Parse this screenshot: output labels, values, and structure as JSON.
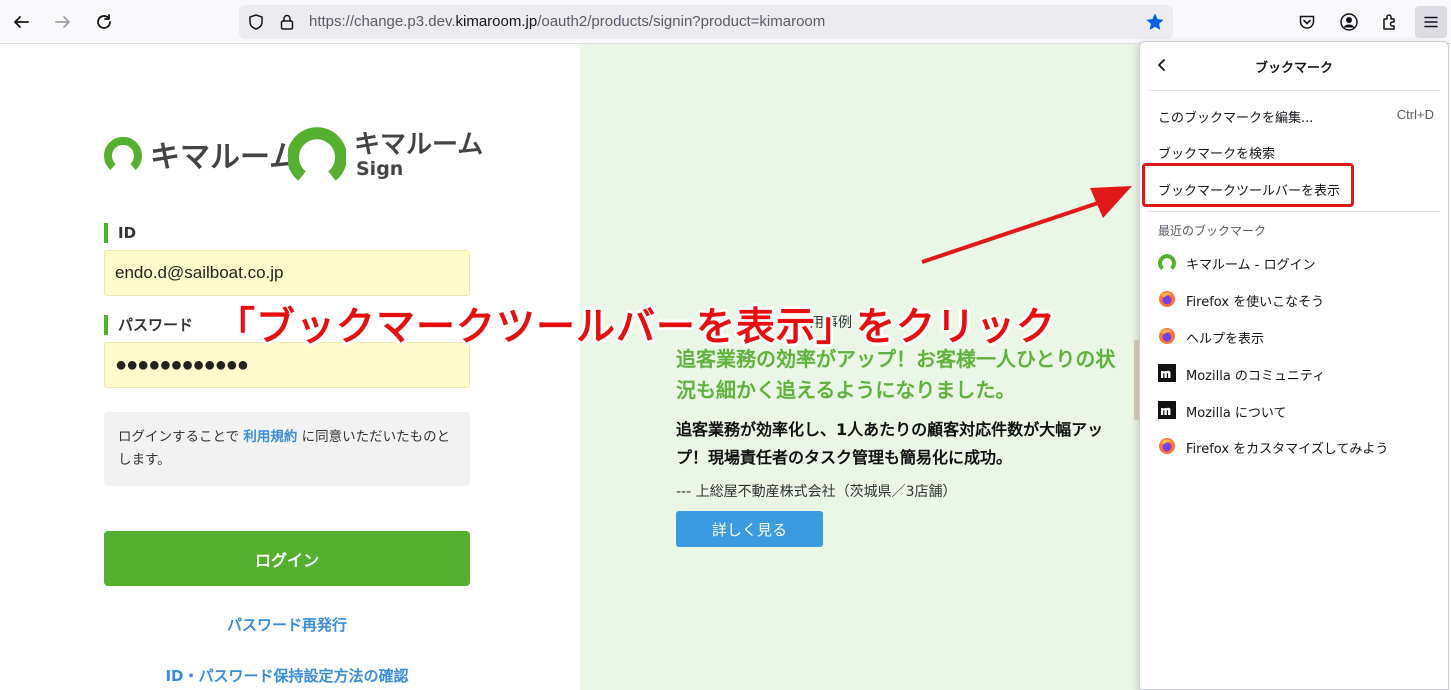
{
  "browser": {
    "url_prefix": "https://change.p3.dev.",
    "url_domain": "kimaroom.jp",
    "url_path": "/oauth2/products/signin?product=kimaroom"
  },
  "login": {
    "logo_main": "キマルーム",
    "logo_sign_main": "キマルーム",
    "logo_sign_sub": "Sign",
    "id_label": "ID",
    "id_value": "endo.d@sailboat.co.jp",
    "password_label": "パスワード",
    "password_value": "●●●●●●●●●●●●",
    "agree_prefix": "ログインすることで ",
    "agree_link": "利用規約",
    "agree_suffix": " に同意いただいたものとします。",
    "login_button": "ログイン",
    "reset_link": "パスワード再発行",
    "settings_link": "ID・パスワード保持設定方法の確認"
  },
  "case_study": {
    "label": "用事例",
    "headline": "追客業務の効率がアップ！お客様一人ひとりの状況も細かく追えるようになりました。",
    "body": "追客業務が効率化し、1人あたりの顧客対応件数が大幅アップ！現場責任者のタスク管理も簡易化に成功。",
    "source": "--- 上総屋不動産株式会社（茨城県／3店舗）",
    "detail_button": "詳しく見る"
  },
  "bookmark_menu": {
    "title": "ブックマーク",
    "edit_label": "このブックマークを編集...",
    "edit_shortcut": "Ctrl+D",
    "search_label": "ブックマークを検索",
    "toolbar_label": "ブックマークツールバーを表示",
    "recent_label": "最近のブックマーク",
    "recent": [
      {
        "label": "キマルーム - ログイン",
        "icon": "kimaroom-icon"
      },
      {
        "label": "Firefox を使いこなそう",
        "icon": "firefox-icon"
      },
      {
        "label": "ヘルプを表示",
        "icon": "firefox-icon"
      },
      {
        "label": "Mozilla のコミュニティ",
        "icon": "mozilla-icon"
      },
      {
        "label": "Mozilla について",
        "icon": "mozilla-icon"
      },
      {
        "label": "Firefox をカスタマイズしてみよう",
        "icon": "firefox-icon"
      }
    ]
  },
  "annotation": {
    "text": "「ブックマークツールバーを表示」をクリック"
  },
  "colors": {
    "brand_green": "#55b030",
    "link_blue": "#3a8ddb",
    "annotation_red": "#e60f0f",
    "bookmark_star": "#0061e0"
  }
}
